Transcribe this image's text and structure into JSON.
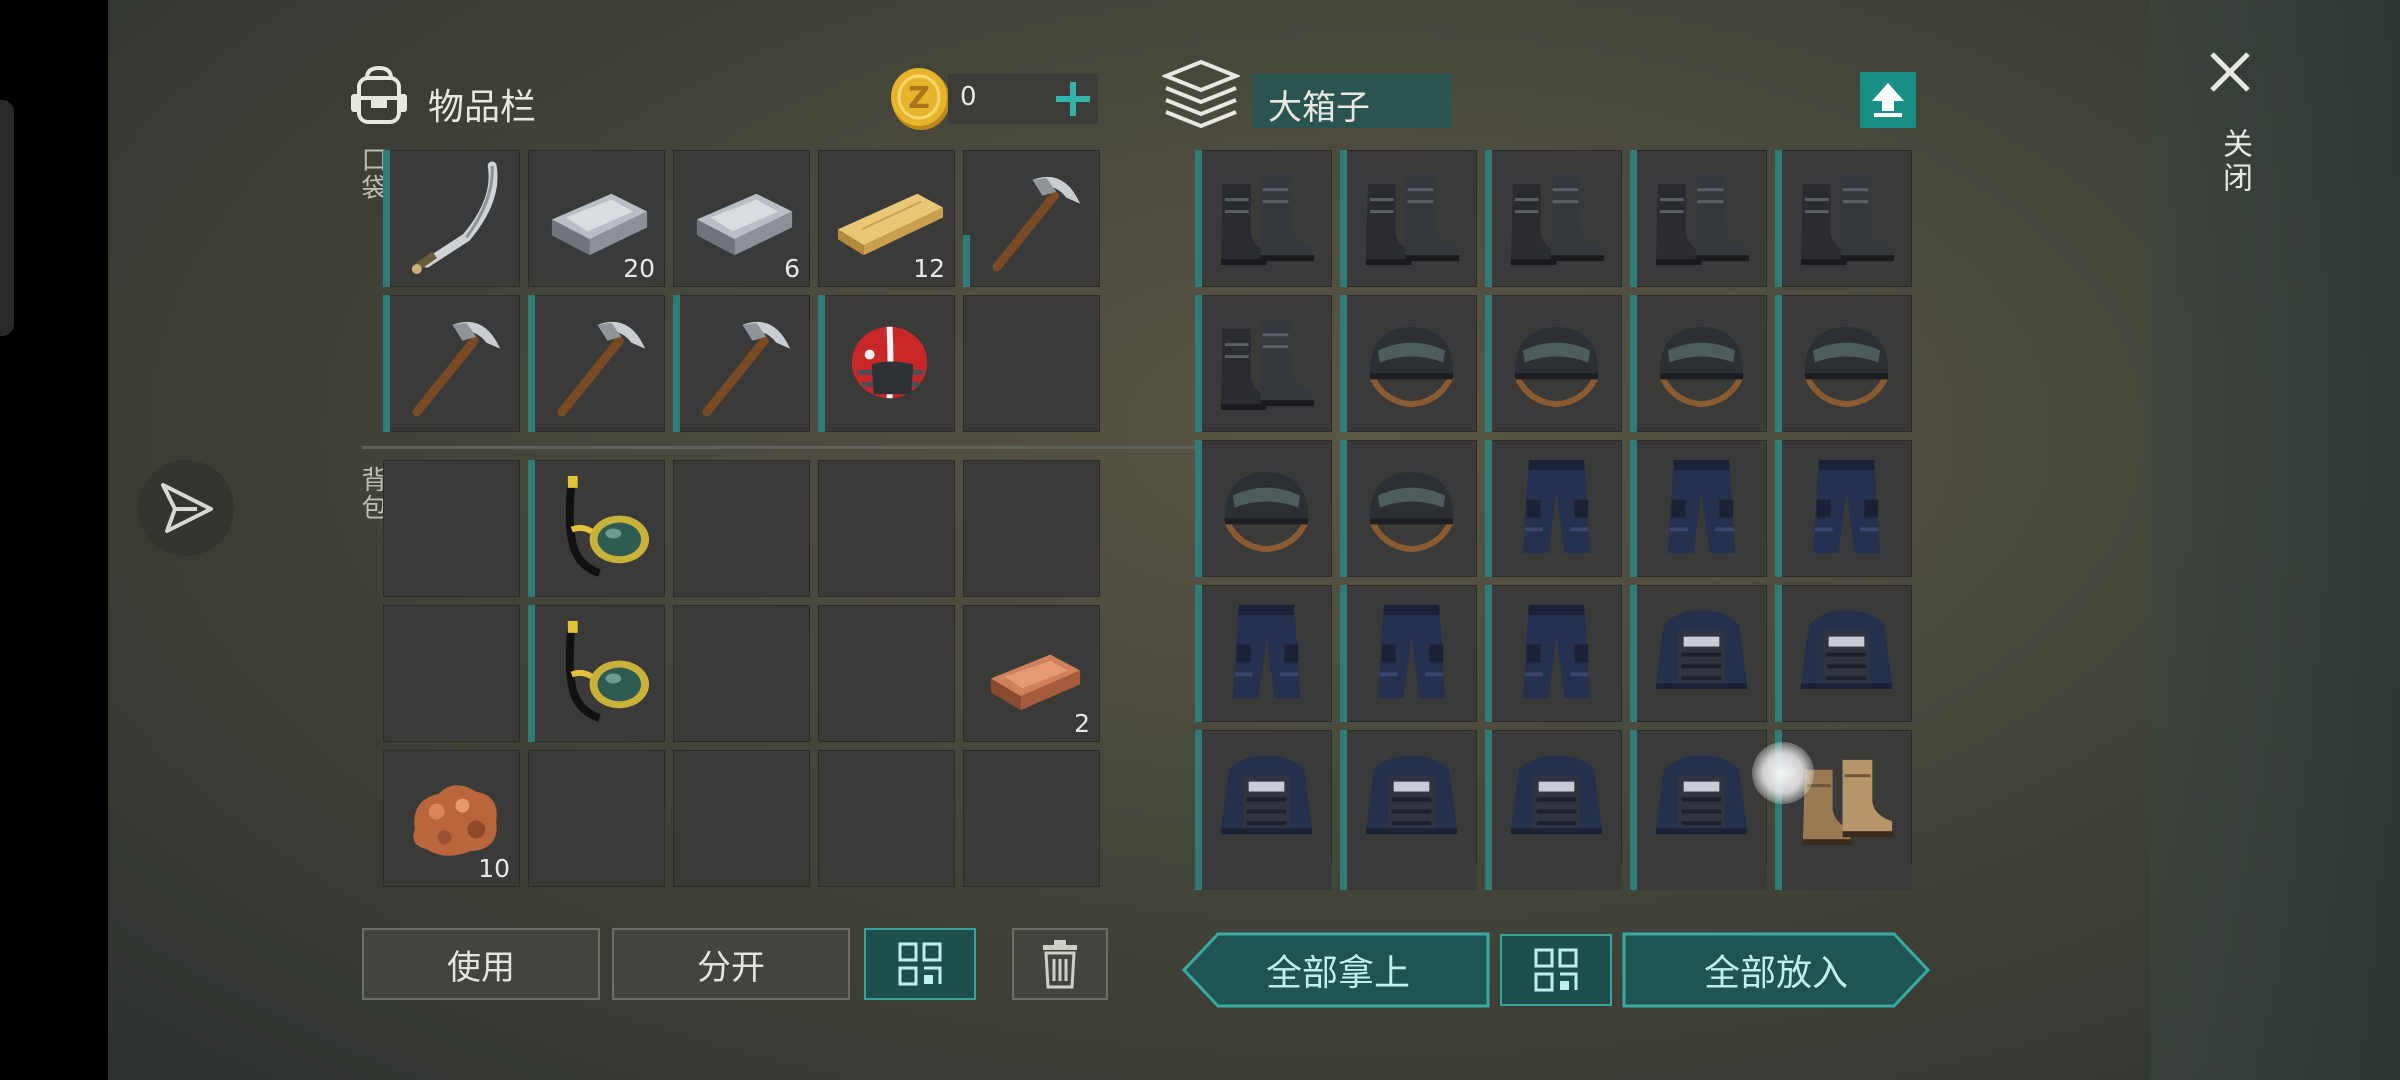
{
  "inventory": {
    "title": "物品栏",
    "coins": "0",
    "pocket_label": "口袋",
    "backpack_label": "背包",
    "pocket_slots": [
      {
        "item": "sword-icon",
        "count": "",
        "bar": "full"
      },
      {
        "item": "iron-bar-icon",
        "count": "20",
        "bar": "none"
      },
      {
        "item": "iron-bar-icon",
        "count": "6",
        "bar": "none"
      },
      {
        "item": "wood-plank-icon",
        "count": "12",
        "bar": "none"
      },
      {
        "item": "pickaxe-icon",
        "count": "",
        "bar": "partial"
      },
      {
        "item": "pickaxe-icon",
        "count": "",
        "bar": "full"
      },
      {
        "item": "pickaxe-icon",
        "count": "",
        "bar": "full"
      },
      {
        "item": "pickaxe-icon",
        "count": "",
        "bar": "full"
      },
      {
        "item": "football-helmet-icon",
        "count": "",
        "bar": "full"
      },
      {
        "item": "",
        "count": "",
        "bar": "none"
      }
    ],
    "backpack_slots": [
      {
        "item": "",
        "count": "",
        "bar": "none"
      },
      {
        "item": "snorkel-mask-icon",
        "count": "",
        "bar": "full"
      },
      {
        "item": "",
        "count": "",
        "bar": "none"
      },
      {
        "item": "",
        "count": "",
        "bar": "none"
      },
      {
        "item": "",
        "count": "",
        "bar": "none"
      },
      {
        "item": "",
        "count": "",
        "bar": "none"
      },
      {
        "item": "snorkel-mask-icon",
        "count": "",
        "bar": "full"
      },
      {
        "item": "",
        "count": "",
        "bar": "none"
      },
      {
        "item": "",
        "count": "",
        "bar": "none"
      },
      {
        "item": "copper-bar-icon",
        "count": "2",
        "bar": "none"
      },
      {
        "item": "copper-ore-icon",
        "count": "10",
        "bar": "none"
      },
      {
        "item": "",
        "count": "",
        "bar": "none"
      },
      {
        "item": "",
        "count": "",
        "bar": "none"
      },
      {
        "item": "",
        "count": "",
        "bar": "none"
      },
      {
        "item": "",
        "count": "",
        "bar": "none"
      }
    ],
    "use_label": "使用",
    "split_label": "分开"
  },
  "chest": {
    "title": "大箱子",
    "slots": [
      {
        "item": "boots-icon",
        "bar": "full"
      },
      {
        "item": "boots-icon",
        "bar": "full"
      },
      {
        "item": "boots-icon",
        "bar": "full"
      },
      {
        "item": "boots-icon",
        "bar": "full"
      },
      {
        "item": "boots-icon",
        "bar": "full"
      },
      {
        "item": "boots-icon",
        "bar": "full"
      },
      {
        "item": "tactical-helmet-icon",
        "bar": "full"
      },
      {
        "item": "tactical-helmet-icon",
        "bar": "full"
      },
      {
        "item": "tactical-helmet-icon",
        "bar": "full"
      },
      {
        "item": "tactical-helmet-icon",
        "bar": "full"
      },
      {
        "item": "tactical-helmet-icon",
        "bar": "full"
      },
      {
        "item": "tactical-helmet-icon",
        "bar": "full"
      },
      {
        "item": "police-pants-icon",
        "bar": "full"
      },
      {
        "item": "police-pants-icon",
        "bar": "full"
      },
      {
        "item": "police-pants-icon",
        "bar": "full"
      },
      {
        "item": "police-pants-icon",
        "bar": "full"
      },
      {
        "item": "police-pants-icon",
        "bar": "full"
      },
      {
        "item": "police-pants-icon",
        "bar": "full"
      },
      {
        "item": "police-vest-icon",
        "bar": "full"
      },
      {
        "item": "police-vest-icon",
        "bar": "full"
      },
      {
        "item": "police-vest-icon",
        "bar": "full"
      },
      {
        "item": "police-vest-icon",
        "bar": "full"
      },
      {
        "item": "police-vest-icon",
        "bar": "full"
      },
      {
        "item": "police-vest-icon",
        "bar": "full"
      },
      {
        "item": "leather-boots-icon",
        "bar": "full"
      }
    ],
    "take_all_label": "全部拿上",
    "put_all_label": "全部放入"
  },
  "close_label": "关闭",
  "colors": {
    "accent": "#2f7c79",
    "slot": "#3a3b39",
    "button_teal": "#1f4f4d"
  }
}
